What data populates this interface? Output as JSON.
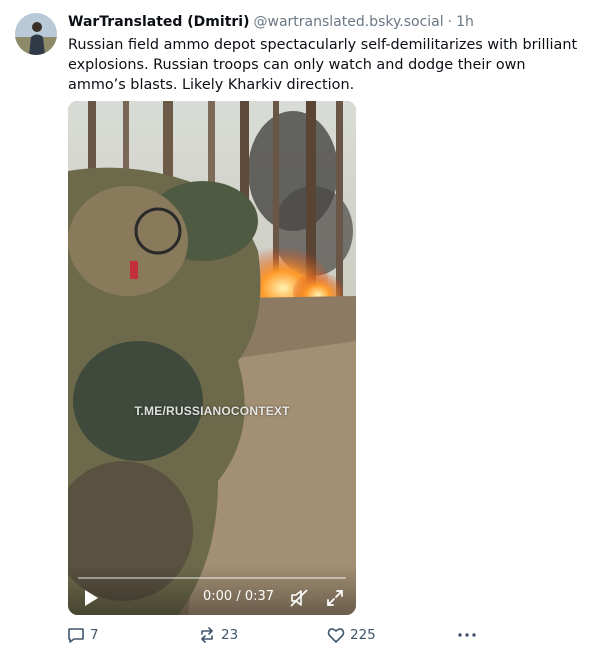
{
  "post": {
    "display_name": "WarTranslated (Dmitri)",
    "handle": "@wartranslated.bsky.social",
    "separator": "·",
    "time": "1h",
    "text": "Russian field ammo depot spectacularly self-demilitarizes with brilliant explosions. Russian troops can only watch and dodge their own ammo’s blasts. Likely Kharkiv direction."
  },
  "video": {
    "watermark": "T.ME/RUSSIANOCONTEXT",
    "time_readout": "0:00 / 0:37",
    "progress": 0,
    "icons": [
      "play-icon",
      "mute-icon",
      "fullscreen-icon"
    ]
  },
  "actions": {
    "reply_count": "7",
    "repost_count": "23",
    "like_count": "225",
    "icons": [
      "reply-icon",
      "repost-icon",
      "like-icon",
      "more-icon"
    ]
  },
  "colors": {
    "text": "#0b0f14",
    "muted": "#6a7886",
    "action": "#42576c"
  }
}
